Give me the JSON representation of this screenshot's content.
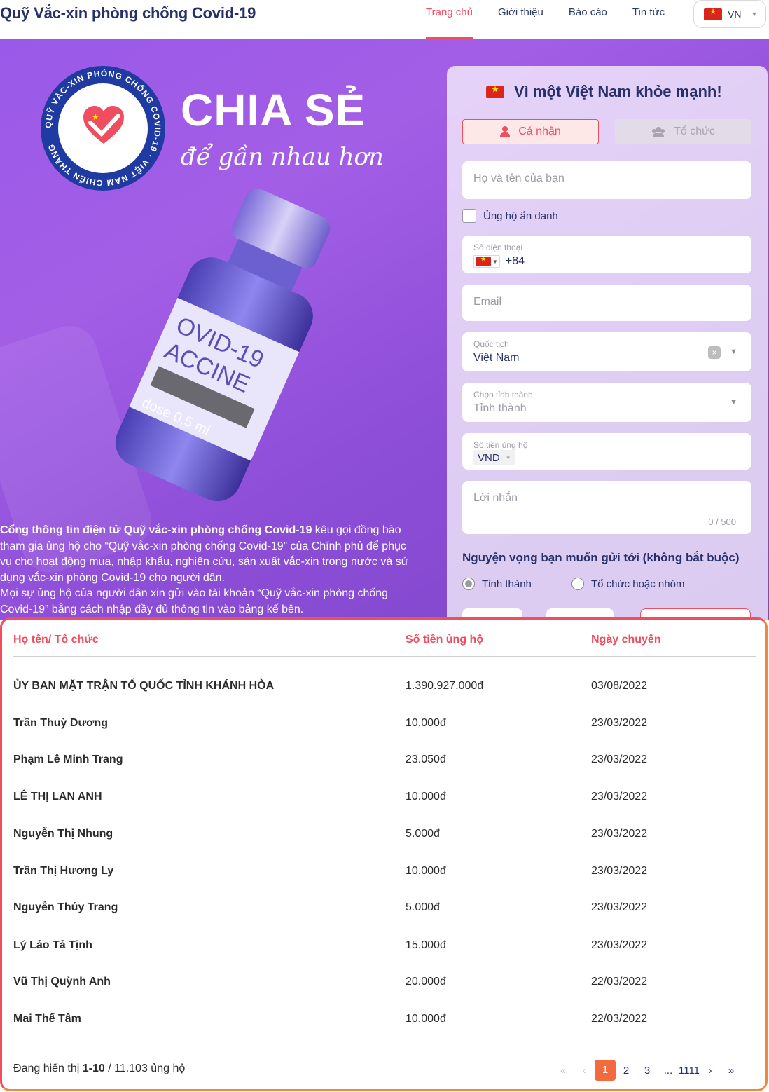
{
  "header": {
    "site_title": "Quỹ Vắc-xin phòng chống Covid-19",
    "nav": [
      "Trang chủ",
      "Giới thiệu",
      "Báo cáo",
      "Tin tức"
    ],
    "lang": "VN"
  },
  "hero": {
    "seal_text": "QUỸ VẮC-XIN PHÒNG CHỐNG COVID-19 · VIỆT NAM CHIẾN THẮNG",
    "headline": "CHIA SẺ",
    "tagline": "để gần nhau hơn",
    "intro_bold": "Cổng thông tin điện tử Quỹ vắc-xin phòng chống Covid-19",
    "intro_rest": " kêu gọi đồng bào tham gia ủng hộ cho “Quỹ vắc-xin phòng chống Covid-19” của Chính phủ để phục vụ cho hoạt động mua, nhập khẩu, nghiên cứu, sản xuất vắc-xin trong nước và sử dụng vắc-xin phòng Covid-19 cho người dân.",
    "intro_second": "Mọi sự ủng hộ của người dân xin gửi vào tài khoản “Quỹ vắc-xin phòng chống Covid-19” bằng cách nhập đầy đủ thông tin vào bảng kế bên."
  },
  "form": {
    "title": "Vì một Việt Nam khỏe mạnh!",
    "tab_individual": "Cá nhân",
    "tab_organization": "Tổ chức",
    "name_placeholder": "Họ và tên của bạn",
    "anonymous_label": "Ủng hộ ẩn danh",
    "phone_label": "Số điện thoại",
    "phone_code": "+84",
    "email_placeholder": "Email",
    "nationality_label": "Quốc tịch",
    "nationality_value": "Việt Nam",
    "province_label": "Chọn tỉnh thành",
    "province_placeholder": "Tỉnh thành",
    "amount_label": "Số tiền ủng hộ",
    "currency": "VND",
    "message_placeholder": "Lời nhắn",
    "message_counter": "0 / 500",
    "wish_title": "Nguyện vọng bạn muốn gửi tới (không bắt buộc)",
    "option_province": "Tỉnh thành",
    "option_org": "Tổ chức hoặc nhóm"
  },
  "table": {
    "headers": [
      "Họ tên/ Tổ chức",
      "Số tiền ủng hộ",
      "Ngày chuyển"
    ],
    "rows": [
      {
        "name": "ỦY BAN MẶT TRẬN TỔ QUỐC TỈNH KHÁNH HÒA",
        "amount": "1.390.927.000đ",
        "date": "03/08/2022"
      },
      {
        "name": "Trần Thuỳ Dương",
        "amount": "10.000đ",
        "date": "23/03/2022"
      },
      {
        "name": "Phạm Lê Minh Trang",
        "amount": "23.050đ",
        "date": "23/03/2022"
      },
      {
        "name": "LÊ THỊ LAN ANH",
        "amount": "10.000đ",
        "date": "23/03/2022"
      },
      {
        "name": "Nguyễn Thị Nhung",
        "amount": "5.000đ",
        "date": "23/03/2022"
      },
      {
        "name": "Trần Thị Hương Ly",
        "amount": "10.000đ",
        "date": "23/03/2022"
      },
      {
        "name": "Nguyễn Thủy Trang",
        "amount": "5.000đ",
        "date": "23/03/2022"
      },
      {
        "name": "Lý Lảo Tả Tịnh",
        "amount": "15.000đ",
        "date": "23/03/2022"
      },
      {
        "name": "Vũ Thị Quỳnh Anh",
        "amount": "20.000đ",
        "date": "22/03/2022"
      },
      {
        "name": "Mai Thế Tâm",
        "amount": "10.000đ",
        "date": "22/03/2022"
      }
    ],
    "showing_prefix": "Đang hiển thị ",
    "showing_range": "1-10",
    "showing_suffix": " / 11.103 ủng hộ",
    "pages": [
      "1",
      "2",
      "3",
      "...",
      "1111"
    ],
    "first_icon": "«",
    "prev_icon": "‹",
    "next_icon": "›",
    "last_icon": "»"
  },
  "colors": {
    "accent": "#f04d5f",
    "navy": "#26306b",
    "hero_purple": "#9a59e8",
    "pager_active": "#f26a3d"
  }
}
